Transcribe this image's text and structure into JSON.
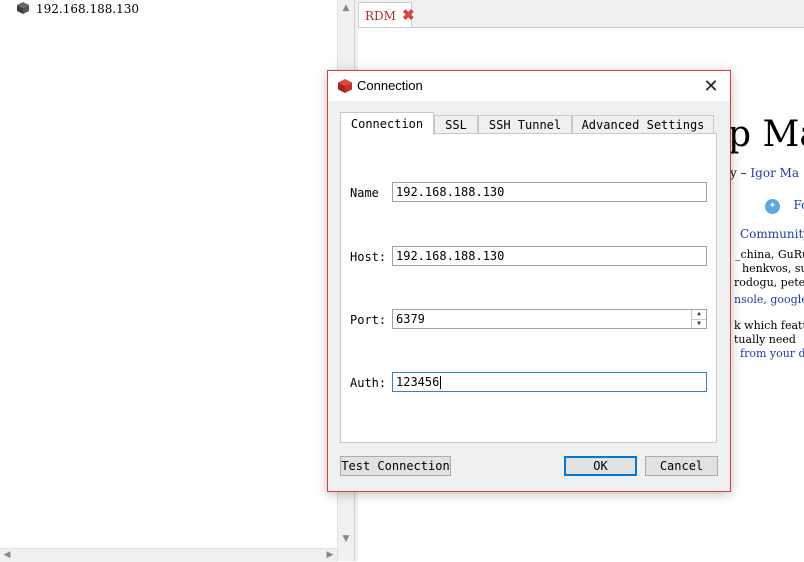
{
  "connection_tree": {
    "server_label": "192.168.188.130"
  },
  "main_tabs": [
    {
      "label": "RDM"
    }
  ],
  "background_page": {
    "heading_fragment": "p  Ma",
    "byline_fragment_1": "y – ",
    "byline_link": "Igor Ma",
    "follow_fragment": "Fo",
    "community_link": "Community",
    "names_line_1": "_china, GuRui",
    "names_line_2": "henkvos, su",
    "names_line_3": "rodogu, pete",
    "links_line": "nsole, google",
    "text_line_1": "k which featu",
    "text_line_2": "tually need",
    "text_line_3": "from your da"
  },
  "dialog": {
    "title": "Connection",
    "tabs": [
      {
        "label": "Connection"
      },
      {
        "label": "SSL"
      },
      {
        "label": "SSH Tunnel"
      },
      {
        "label": "Advanced Settings"
      }
    ],
    "fields": {
      "name": {
        "label": "Name",
        "value": "192.168.188.130"
      },
      "host": {
        "label": "Host:",
        "value": "192.168.188.130"
      },
      "port": {
        "label": "Port:",
        "value": "6379"
      },
      "auth": {
        "label": "Auth:",
        "value": "123456"
      }
    },
    "buttons": {
      "test_connection": "Test Connection",
      "ok": "OK",
      "cancel": "Cancel"
    }
  },
  "colors": {
    "accent_red": "#d33f3f",
    "link_blue": "#1f3aa8",
    "focus_blue": "#0078d7"
  }
}
